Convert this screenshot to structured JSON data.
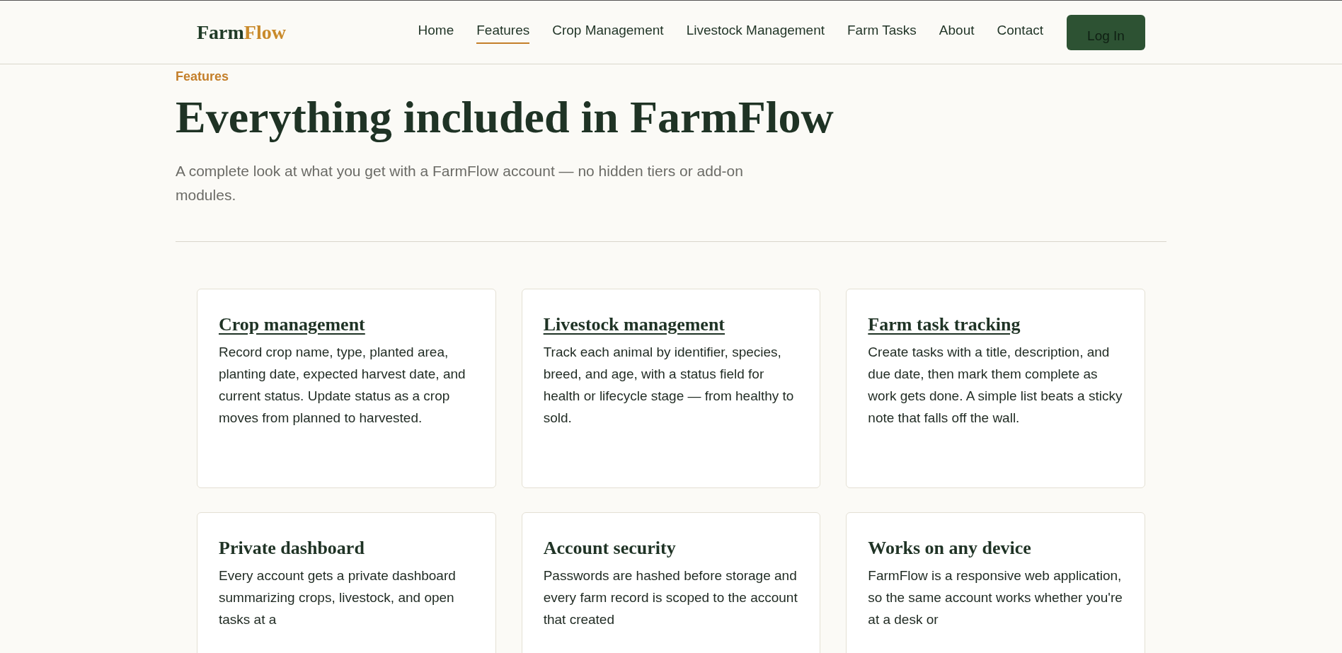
{
  "header": {
    "logo": {
      "part_1": "Farm",
      "part_2": "Flow"
    },
    "nav": [
      {
        "label": "Home",
        "selected": false
      },
      {
        "label": "Features",
        "selected": true
      },
      {
        "label": "Crop Management",
        "selected": false
      },
      {
        "label": "Livestock Management",
        "selected": false
      },
      {
        "label": "Farm Tasks",
        "selected": false
      },
      {
        "label": "About",
        "selected": false
      },
      {
        "label": "Contact",
        "selected": false
      }
    ],
    "login_button": "Log In"
  },
  "hero": {
    "eyebrow": "Features",
    "title": "Everything included in FarmFlow",
    "subtitle": "A complete look at what you get with a FarmFlow account — no hidden tiers or add-on modules."
  },
  "features": [
    {
      "kind": "link",
      "title": "Crop management",
      "text": "Record crop name, type, planted area, planting date, expected harvest date, and current status. Update status as a crop moves from planned to harvested."
    },
    {
      "kind": "link",
      "title": "Livestock management",
      "text": "Track each animal by identifier, species, breed, and age, with a status field for health or lifecycle stage — from healthy to sold."
    },
    {
      "kind": "link",
      "title": "Farm task tracking",
      "text": "Create tasks with a title, description, and due date, then mark them complete as work gets done. A simple list beats a sticky note that falls off the wall."
    },
    {
      "kind": "plain",
      "title": "Private dashboard",
      "text": "Every account gets a private dashboard summarizing crops, livestock, and open tasks at a"
    },
    {
      "kind": "plain",
      "title": "Account security",
      "text": "Passwords are hashed before storage and every farm record is scoped to the account that created"
    },
    {
      "kind": "plain",
      "title": "Works on any device",
      "text": "FarmFlow is a responsive web application, so the same account works whether you're at a desk or"
    }
  ]
}
